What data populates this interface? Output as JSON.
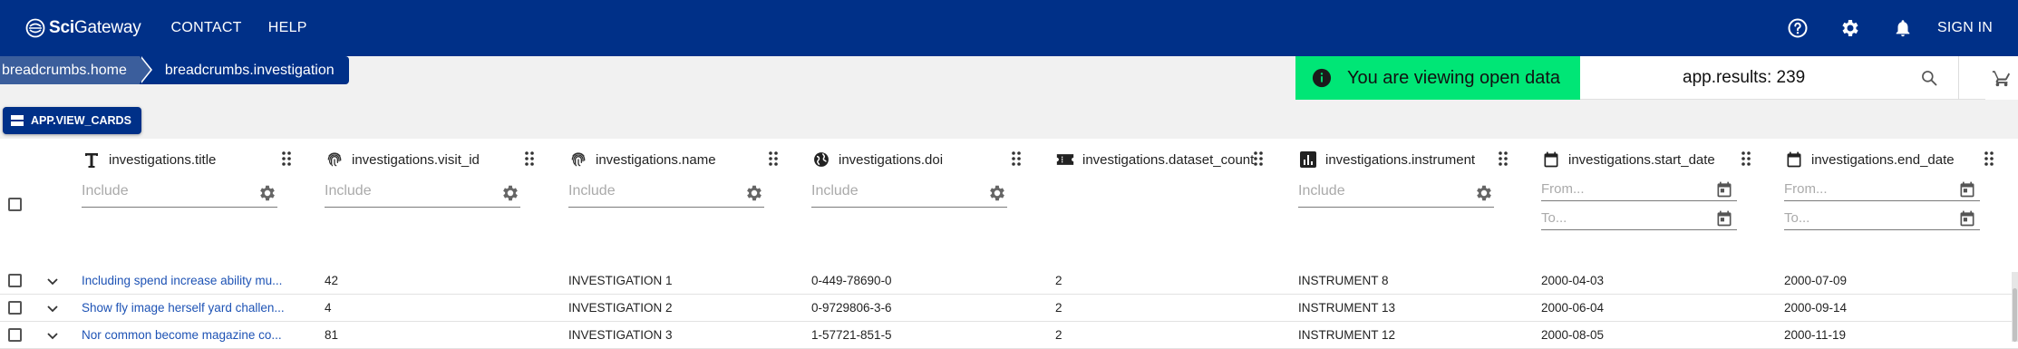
{
  "app": {
    "logo_bold": "Sci",
    "logo_rest": "Gateway",
    "sign_in": "SIGN IN"
  },
  "nav": {
    "contact": "CONTACT",
    "help": "HELP"
  },
  "breadcrumbs": {
    "home": "breadcrumbs.home",
    "current": "breadcrumbs.investigation"
  },
  "banner": {
    "open_data": "You are viewing open data"
  },
  "results": {
    "label": "app.results:",
    "count": "239"
  },
  "view_cards_label": "APP.VIEW_CARDS",
  "columns": [
    {
      "title": "investigations.title",
      "icon": "text-icon",
      "filter": "Include"
    },
    {
      "title": "investigations.visit_id",
      "icon": "fingerprint-icon",
      "filter": "Include"
    },
    {
      "title": "investigations.name",
      "icon": "fingerprint-icon",
      "filter": "Include"
    },
    {
      "title": "investigations.doi",
      "icon": "globe-icon",
      "filter": "Include"
    },
    {
      "title": "investigations.dataset_count",
      "icon": "ticket-icon",
      "filter": ""
    },
    {
      "title": "investigations.instrument",
      "icon": "bar-chart-icon",
      "filter": "Include"
    },
    {
      "title": "investigations.start_date",
      "icon": "calendar-icon",
      "from": "From...",
      "to": "To..."
    },
    {
      "title": "investigations.end_date",
      "icon": "calendar-icon",
      "from": "From...",
      "to": "To..."
    }
  ],
  "rows": [
    {
      "title": "Including spend increase ability mu...",
      "visit_id": "42",
      "name": "INVESTIGATION 1",
      "doi": "0-449-78690-0",
      "dataset_count": "2",
      "instrument": "INSTRUMENT 8",
      "start_date": "2000-04-03",
      "end_date": "2000-07-09"
    },
    {
      "title": "Show fly image herself yard challen...",
      "visit_id": "4",
      "name": "INVESTIGATION 2",
      "doi": "0-9729806-3-6",
      "dataset_count": "2",
      "instrument": "INSTRUMENT 13",
      "start_date": "2000-06-04",
      "end_date": "2000-09-14"
    },
    {
      "title": "Nor common become magazine co...",
      "visit_id": "81",
      "name": "INVESTIGATION 3",
      "doi": "1-57721-851-5",
      "dataset_count": "2",
      "instrument": "INSTRUMENT 12",
      "start_date": "2000-08-05",
      "end_date": "2000-11-19"
    }
  ],
  "colors": {
    "primary": "#003088",
    "breadcrumb_home": "#3b5e9c",
    "open_data": "#00e676",
    "link": "#1e53b5"
  }
}
